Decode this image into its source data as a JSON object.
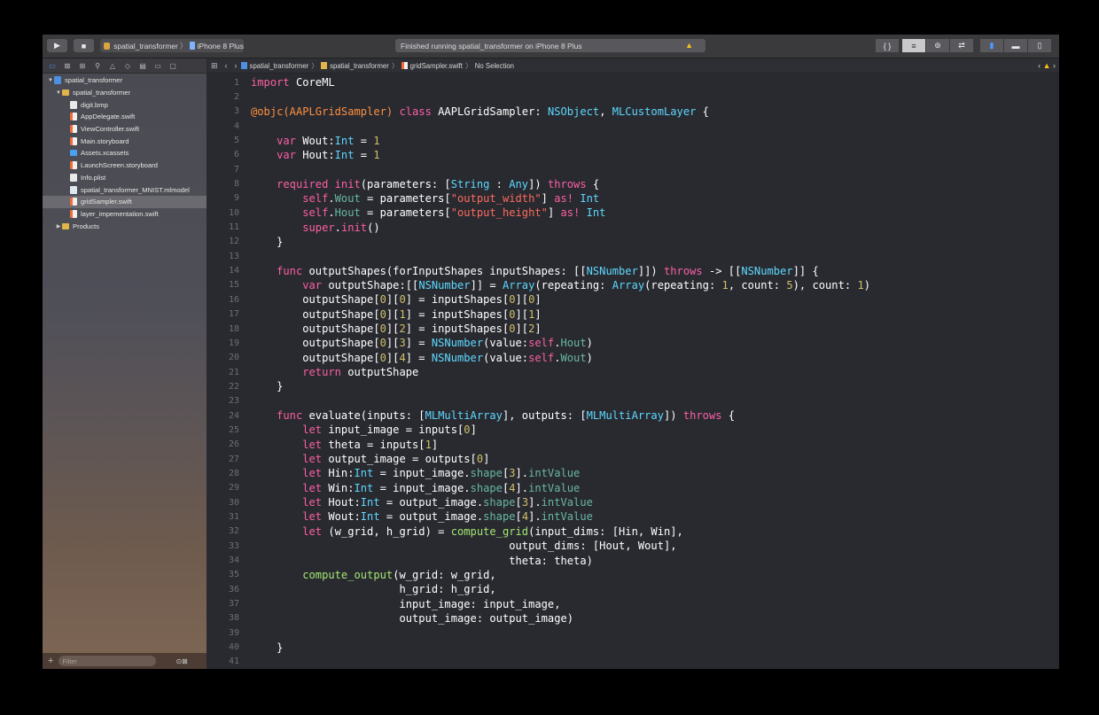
{
  "toolbar": {
    "run_icon": "play-icon",
    "stop_icon": "stop-icon",
    "scheme_name": "spatial_transformer",
    "device_name": "iPhone 8 Plus",
    "status_text": "Finished running spatial_transformer on iPhone 8 Plus",
    "status_warning_icon": "warning-icon",
    "editor_modes": [
      "{ }",
      "≡",
      "⊚",
      "⇄"
    ],
    "panels": [
      "▮",
      "▬",
      "▯"
    ]
  },
  "navigator": {
    "tab_icons": [
      "folder-icon",
      "source-control-icon",
      "symbol-icon",
      "search-icon",
      "warning-icon",
      "test-icon",
      "debug-icon",
      "breakpoint-icon",
      "report-icon"
    ],
    "items": [
      {
        "label": "spatial_transformer",
        "icon": "project",
        "indent": 0,
        "disclosure": "open"
      },
      {
        "label": "spatial_transformer",
        "icon": "folder",
        "indent": 1,
        "disclosure": "open"
      },
      {
        "label": "digit.bmp",
        "icon": "file",
        "indent": 2,
        "disclosure": ""
      },
      {
        "label": "AppDelegate.swift",
        "icon": "swift",
        "indent": 2,
        "disclosure": ""
      },
      {
        "label": "ViewController.swift",
        "icon": "swift",
        "indent": 2,
        "disclosure": ""
      },
      {
        "label": "Main.storyboard",
        "icon": "swift",
        "indent": 2,
        "disclosure": ""
      },
      {
        "label": "Assets.xcassets",
        "icon": "assets",
        "indent": 2,
        "disclosure": ""
      },
      {
        "label": "LaunchScreen.storyboard",
        "icon": "swift",
        "indent": 2,
        "disclosure": ""
      },
      {
        "label": "Info.plist",
        "icon": "file",
        "indent": 2,
        "disclosure": ""
      },
      {
        "label": "spatial_transformer_MNIST.mlmodel",
        "icon": "model",
        "indent": 2,
        "disclosure": ""
      },
      {
        "label": "gridSampler.swift",
        "icon": "swift",
        "indent": 2,
        "disclosure": "",
        "selected": true
      },
      {
        "label": "layer_impementation.swift",
        "icon": "swift",
        "indent": 2,
        "disclosure": ""
      },
      {
        "label": "Products",
        "icon": "folder",
        "indent": 1,
        "disclosure": "closed"
      }
    ],
    "filter_placeholder": "Filter"
  },
  "jumpbar": {
    "crumbs": [
      "spatial_transformer",
      "spatial_transformer",
      "gridSampler.swift",
      "No Selection"
    ]
  },
  "code": {
    "lines": [
      {
        "num": "1",
        "tokens": [
          [
            "k",
            "import"
          ],
          [
            "o",
            " CoreML"
          ]
        ]
      },
      {
        "num": "2",
        "tokens": []
      },
      {
        "num": "3",
        "tokens": [
          [
            "at",
            "@objc(AAPLGridSampler)"
          ],
          [
            "o",
            " "
          ],
          [
            "k",
            "class"
          ],
          [
            "o",
            " AAPLGridSampler: "
          ],
          [
            "t",
            "NSObject"
          ],
          [
            "o",
            ", "
          ],
          [
            "t",
            "MLCustomLayer"
          ],
          [
            "o",
            " {"
          ]
        ]
      },
      {
        "num": "4",
        "tokens": []
      },
      {
        "num": "5",
        "tokens": [
          [
            "o",
            "    "
          ],
          [
            "k",
            "var"
          ],
          [
            "o",
            " Wout:"
          ],
          [
            "t",
            "Int"
          ],
          [
            "o",
            " = "
          ],
          [
            "n",
            "1"
          ]
        ]
      },
      {
        "num": "6",
        "tokens": [
          [
            "o",
            "    "
          ],
          [
            "k",
            "var"
          ],
          [
            "o",
            " Hout:"
          ],
          [
            "t",
            "Int"
          ],
          [
            "o",
            " = "
          ],
          [
            "n",
            "1"
          ]
        ]
      },
      {
        "num": "7",
        "tokens": []
      },
      {
        "num": "8",
        "tokens": [
          [
            "o",
            "    "
          ],
          [
            "k",
            "required"
          ],
          [
            "o",
            " "
          ],
          [
            "k",
            "init"
          ],
          [
            "o",
            "(parameters: ["
          ],
          [
            "t",
            "String"
          ],
          [
            "o",
            " : "
          ],
          [
            "t",
            "Any"
          ],
          [
            "o",
            "]) "
          ],
          [
            "k",
            "throws"
          ],
          [
            "o",
            " {"
          ]
        ]
      },
      {
        "num": "9",
        "tokens": [
          [
            "o",
            "        "
          ],
          [
            "k",
            "self"
          ],
          [
            "o",
            "."
          ],
          [
            "f",
            "Wout"
          ],
          [
            "o",
            " = parameters["
          ],
          [
            "s",
            "\"output_width\""
          ],
          [
            "o",
            "] "
          ],
          [
            "k",
            "as!"
          ],
          [
            "o",
            " "
          ],
          [
            "t",
            "Int"
          ]
        ]
      },
      {
        "num": "10",
        "tokens": [
          [
            "o",
            "        "
          ],
          [
            "k",
            "self"
          ],
          [
            "o",
            "."
          ],
          [
            "f",
            "Hout"
          ],
          [
            "o",
            " = parameters["
          ],
          [
            "s",
            "\"output_height\""
          ],
          [
            "o",
            "] "
          ],
          [
            "k",
            "as!"
          ],
          [
            "o",
            " "
          ],
          [
            "t",
            "Int"
          ]
        ]
      },
      {
        "num": "11",
        "tokens": [
          [
            "o",
            "        "
          ],
          [
            "k",
            "super"
          ],
          [
            "o",
            "."
          ],
          [
            "k",
            "init"
          ],
          [
            "o",
            "()"
          ]
        ]
      },
      {
        "num": "12",
        "tokens": [
          [
            "o",
            "    }"
          ]
        ]
      },
      {
        "num": "13",
        "tokens": []
      },
      {
        "num": "14",
        "tokens": [
          [
            "o",
            "    "
          ],
          [
            "k",
            "func"
          ],
          [
            "o",
            " outputShapes(forInputShapes inputShapes: [["
          ],
          [
            "t",
            "NSNumber"
          ],
          [
            "o",
            "]]) "
          ],
          [
            "k",
            "throws"
          ],
          [
            "o",
            " -> [["
          ],
          [
            "t",
            "NSNumber"
          ],
          [
            "o",
            "]] {"
          ]
        ]
      },
      {
        "num": "15",
        "tokens": [
          [
            "o",
            "        "
          ],
          [
            "k",
            "var"
          ],
          [
            "o",
            " outputShape:[["
          ],
          [
            "t",
            "NSNumber"
          ],
          [
            "o",
            "]] = "
          ],
          [
            "t",
            "Array"
          ],
          [
            "o",
            "(repeating: "
          ],
          [
            "t",
            "Array"
          ],
          [
            "o",
            "(repeating: "
          ],
          [
            "n",
            "1"
          ],
          [
            "o",
            ", count: "
          ],
          [
            "n",
            "5"
          ],
          [
            "o",
            "), count: "
          ],
          [
            "n",
            "1"
          ],
          [
            "o",
            ")"
          ]
        ]
      },
      {
        "num": "16",
        "tokens": [
          [
            "o",
            "        outputShape["
          ],
          [
            "n",
            "0"
          ],
          [
            "o",
            "]["
          ],
          [
            "n",
            "0"
          ],
          [
            "o",
            "] = inputShapes["
          ],
          [
            "n",
            "0"
          ],
          [
            "o",
            "]["
          ],
          [
            "n",
            "0"
          ],
          [
            "o",
            "]"
          ]
        ]
      },
      {
        "num": "17",
        "tokens": [
          [
            "o",
            "        outputShape["
          ],
          [
            "n",
            "0"
          ],
          [
            "o",
            "]["
          ],
          [
            "n",
            "1"
          ],
          [
            "o",
            "] = inputShapes["
          ],
          [
            "n",
            "0"
          ],
          [
            "o",
            "]["
          ],
          [
            "n",
            "1"
          ],
          [
            "o",
            "]"
          ]
        ]
      },
      {
        "num": "18",
        "tokens": [
          [
            "o",
            "        outputShape["
          ],
          [
            "n",
            "0"
          ],
          [
            "o",
            "]["
          ],
          [
            "n",
            "2"
          ],
          [
            "o",
            "] = inputShapes["
          ],
          [
            "n",
            "0"
          ],
          [
            "o",
            "]["
          ],
          [
            "n",
            "2"
          ],
          [
            "o",
            "]"
          ]
        ]
      },
      {
        "num": "19",
        "tokens": [
          [
            "o",
            "        outputShape["
          ],
          [
            "n",
            "0"
          ],
          [
            "o",
            "]["
          ],
          [
            "n",
            "3"
          ],
          [
            "o",
            "] = "
          ],
          [
            "t",
            "NSNumber"
          ],
          [
            "o",
            "(value:"
          ],
          [
            "k",
            "self"
          ],
          [
            "o",
            "."
          ],
          [
            "f",
            "Hout"
          ],
          [
            "o",
            ")"
          ]
        ]
      },
      {
        "num": "20",
        "tokens": [
          [
            "o",
            "        outputShape["
          ],
          [
            "n",
            "0"
          ],
          [
            "o",
            "]["
          ],
          [
            "n",
            "4"
          ],
          [
            "o",
            "] = "
          ],
          [
            "t",
            "NSNumber"
          ],
          [
            "o",
            "(value:"
          ],
          [
            "k",
            "self"
          ],
          [
            "o",
            "."
          ],
          [
            "f",
            "Wout"
          ],
          [
            "o",
            ")"
          ]
        ]
      },
      {
        "num": "21",
        "tokens": [
          [
            "o",
            "        "
          ],
          [
            "k",
            "return"
          ],
          [
            "o",
            " outputShape"
          ]
        ]
      },
      {
        "num": "22",
        "tokens": [
          [
            "o",
            "    }"
          ]
        ]
      },
      {
        "num": "23",
        "tokens": []
      },
      {
        "num": "24",
        "tokens": [
          [
            "o",
            "    "
          ],
          [
            "k",
            "func"
          ],
          [
            "o",
            " evaluate(inputs: ["
          ],
          [
            "t",
            "MLMultiArray"
          ],
          [
            "o",
            "], outputs: ["
          ],
          [
            "t",
            "MLMultiArray"
          ],
          [
            "o",
            "]) "
          ],
          [
            "k",
            "throws"
          ],
          [
            "o",
            " {"
          ]
        ]
      },
      {
        "num": "25",
        "tokens": [
          [
            "o",
            "        "
          ],
          [
            "k",
            "let"
          ],
          [
            "o",
            " input_image = inputs["
          ],
          [
            "n",
            "0"
          ],
          [
            "o",
            "]"
          ]
        ]
      },
      {
        "num": "26",
        "tokens": [
          [
            "o",
            "        "
          ],
          [
            "k",
            "let"
          ],
          [
            "o",
            " theta = inputs["
          ],
          [
            "n",
            "1"
          ],
          [
            "o",
            "]"
          ]
        ]
      },
      {
        "num": "27",
        "tokens": [
          [
            "o",
            "        "
          ],
          [
            "k",
            "let"
          ],
          [
            "o",
            " output_image = outputs["
          ],
          [
            "n",
            "0"
          ],
          [
            "o",
            "]"
          ]
        ]
      },
      {
        "num": "28",
        "tokens": [
          [
            "o",
            "        "
          ],
          [
            "k",
            "let"
          ],
          [
            "o",
            " Hin:"
          ],
          [
            "t",
            "Int"
          ],
          [
            "o",
            " = input_image."
          ],
          [
            "f",
            "shape"
          ],
          [
            "o",
            "["
          ],
          [
            "n",
            "3"
          ],
          [
            "o",
            "]."
          ],
          [
            "f",
            "intValue"
          ]
        ]
      },
      {
        "num": "29",
        "tokens": [
          [
            "o",
            "        "
          ],
          [
            "k",
            "let"
          ],
          [
            "o",
            " Win:"
          ],
          [
            "t",
            "Int"
          ],
          [
            "o",
            " = input_image."
          ],
          [
            "f",
            "shape"
          ],
          [
            "o",
            "["
          ],
          [
            "n",
            "4"
          ],
          [
            "o",
            "]."
          ],
          [
            "f",
            "intValue"
          ]
        ]
      },
      {
        "num": "30",
        "tokens": [
          [
            "o",
            "        "
          ],
          [
            "k",
            "let"
          ],
          [
            "o",
            " Hout:"
          ],
          [
            "t",
            "Int"
          ],
          [
            "o",
            " = output_image."
          ],
          [
            "f",
            "shape"
          ],
          [
            "o",
            "["
          ],
          [
            "n",
            "3"
          ],
          [
            "o",
            "]."
          ],
          [
            "f",
            "intValue"
          ]
        ]
      },
      {
        "num": "31",
        "tokens": [
          [
            "o",
            "        "
          ],
          [
            "k",
            "let"
          ],
          [
            "o",
            " Wout:"
          ],
          [
            "t",
            "Int"
          ],
          [
            "o",
            " = output_image."
          ],
          [
            "f",
            "shape"
          ],
          [
            "o",
            "["
          ],
          [
            "n",
            "4"
          ],
          [
            "o",
            "]."
          ],
          [
            "f",
            "intValue"
          ]
        ]
      },
      {
        "num": "32",
        "tokens": [
          [
            "o",
            "        "
          ],
          [
            "k",
            "let"
          ],
          [
            "o",
            " (w_grid, h_grid) = "
          ],
          [
            "m",
            "compute_grid"
          ],
          [
            "o",
            "(input_dims: [Hin, Win],"
          ]
        ]
      },
      {
        "num": "33",
        "tokens": [
          [
            "o",
            "                                        output_dims: [Hout, Wout],"
          ]
        ]
      },
      {
        "num": "34",
        "tokens": [
          [
            "o",
            "                                        theta: theta)"
          ]
        ]
      },
      {
        "num": "35",
        "tokens": [
          [
            "o",
            "        "
          ],
          [
            "m",
            "compute_output"
          ],
          [
            "o",
            "(w_grid: w_grid,"
          ]
        ]
      },
      {
        "num": "36",
        "tokens": [
          [
            "o",
            "                       h_grid: h_grid,"
          ]
        ]
      },
      {
        "num": "37",
        "tokens": [
          [
            "o",
            "                       input_image: input_image,"
          ]
        ]
      },
      {
        "num": "38",
        "tokens": [
          [
            "o",
            "                       output_image: output_image)"
          ]
        ]
      },
      {
        "num": "39",
        "tokens": []
      },
      {
        "num": "40",
        "tokens": [
          [
            "o",
            "    }"
          ]
        ]
      },
      {
        "num": "41",
        "tokens": []
      }
    ]
  },
  "colors": {
    "editor_bg": "#292a30",
    "keyword": "#fc5fa3",
    "type": "#5dd8ff",
    "string": "#fc6a5d",
    "number": "#d0bf69",
    "accent": "#4e9bff"
  }
}
